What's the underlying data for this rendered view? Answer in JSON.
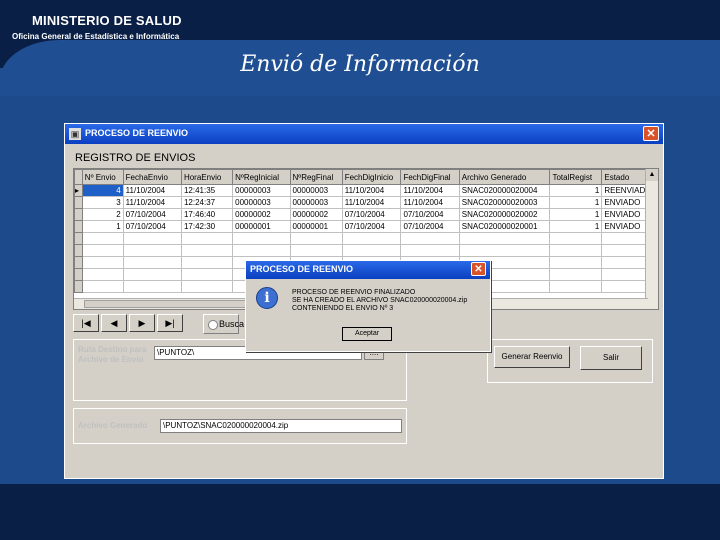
{
  "slide": {
    "ministry": "MINISTERIO DE SALUD",
    "office": "Oficina General de Estadística e Informática",
    "title": "Envió de Información"
  },
  "window": {
    "title": "PROCESO DE REENVIO",
    "section_title": "REGISTRO DE ENVIOS",
    "columns": [
      "Nº Envio",
      "FechaEnvio",
      "HoraEnvio",
      "NºRegInicial",
      "NºRegFinal",
      "FechDigInicio",
      "FechDigFinal",
      "Archivo Generado",
      "TotalRegist",
      "Estado"
    ],
    "rows": [
      [
        "4",
        "11/10/2004",
        "12:41:35",
        "00000003",
        "00000003",
        "11/10/2004",
        "11/10/2004",
        "SNAC020000020004",
        "1",
        "REENVIADO"
      ],
      [
        "3",
        "11/10/2004",
        "12:24:37",
        "00000003",
        "00000003",
        "11/10/2004",
        "11/10/2004",
        "SNAC020000020003",
        "1",
        "ENVIADO"
      ],
      [
        "2",
        "07/10/2004",
        "17:46:40",
        "00000002",
        "00000002",
        "07/10/2004",
        "07/10/2004",
        "SNAC020000020002",
        "1",
        "ENVIADO"
      ],
      [
        "1",
        "07/10/2004",
        "17:42:30",
        "00000001",
        "00000001",
        "07/10/2004",
        "07/10/2004",
        "SNAC020000020001",
        "1",
        "ENVIADO"
      ]
    ],
    "empty_rows": 5,
    "nav": {
      "first": "|◀",
      "prev": "◀",
      "next": "▶",
      "last": "▶|"
    },
    "search_label": "Busca",
    "destino_label": "Ruta Destino para Archivo de Envio",
    "destino_value": "\\PUNTOZ\\",
    "browse_label": "....",
    "archivo_label": "Archivo Generado",
    "archivo_value": "\\PUNTOZ\\SNAC020000020004.zip",
    "btn_regenerar": "Generar Reenvio",
    "btn_salir": "Salir"
  },
  "dialog": {
    "title": "PROCESO DE REENVIO",
    "line1": "PROCESO DE REENVIO FINALIZADO",
    "line2": "SE HA CREADO EL ARCHIVO SNAC020000020004.zip",
    "line3": "CONTENIENDO EL ENVIO Nº       3",
    "ok": "Aceptar"
  },
  "icons": {
    "app": "app-icon",
    "close": "close-icon",
    "info": "info-icon"
  }
}
